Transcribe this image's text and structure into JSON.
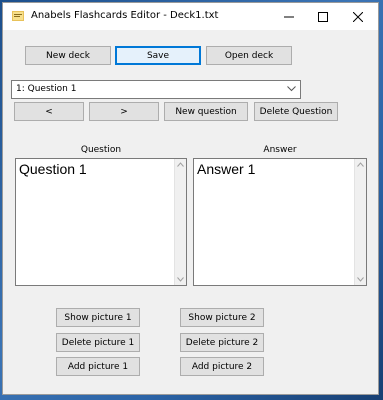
{
  "window": {
    "title": "Anabels Flashcards Editor - Deck1.txt"
  },
  "toolbar": {
    "new_deck": "New deck",
    "save": "Save",
    "open_deck": "Open deck"
  },
  "question_select": {
    "selected": "1: Question 1"
  },
  "navigation": {
    "prev": "<",
    "next": ">",
    "new_question": "New question",
    "delete_question": "Delete Question"
  },
  "editor": {
    "question_label": "Question",
    "answer_label": "Answer",
    "question_text": "Question 1",
    "answer_text": "Answer 1"
  },
  "pictures": {
    "show1": "Show picture 1",
    "delete1": "Delete picture 1",
    "add1": "Add picture 1",
    "show2": "Show picture 2",
    "delete2": "Delete picture 2",
    "add2": "Add picture 2"
  },
  "colors": {
    "accent": "#0078d7",
    "window_bg": "#f0f0f0",
    "button_bg": "#e1e1e1"
  }
}
